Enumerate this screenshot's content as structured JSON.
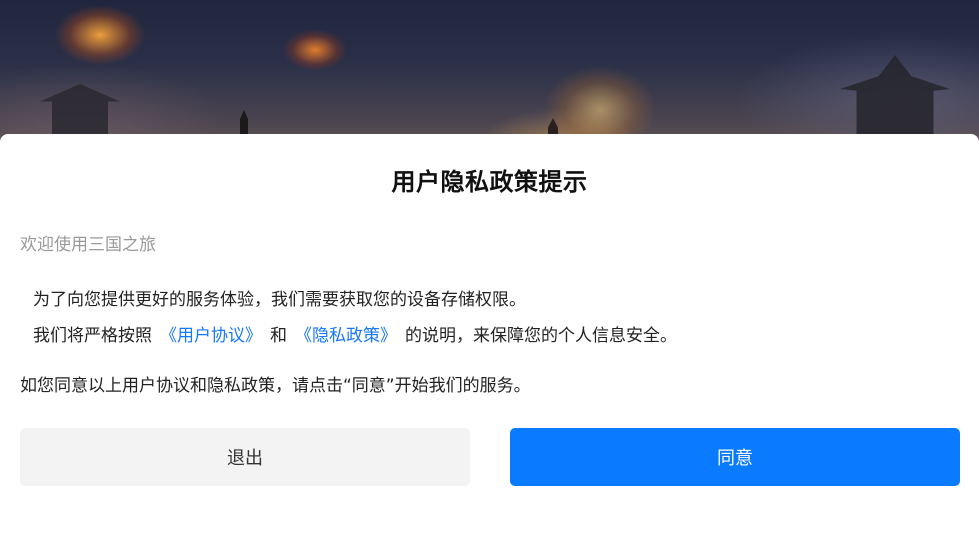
{
  "dialog": {
    "title": "用户隐私政策提示",
    "welcome": "欢迎使用三国之旅",
    "line1": "为了向您提供更好的服务体验，我们需要获取您的设备存储权限。",
    "line2_prefix": "我们将严格按照",
    "user_agreement_link": "《用户协议》",
    "line2_and": "和",
    "privacy_policy_link": "《隐私政策》",
    "line2_suffix": "的说明，来保障您的个人信息安全。",
    "line3": "如您同意以上用户协议和隐私政策，请点击“同意”开始我们的服务。",
    "exit_label": "退出",
    "agree_label": "同意"
  },
  "colors": {
    "accent": "#0a7bff",
    "link": "#1677ff",
    "exit_button_bg": "#f3f3f3",
    "muted_text": "#9a9a9a"
  }
}
